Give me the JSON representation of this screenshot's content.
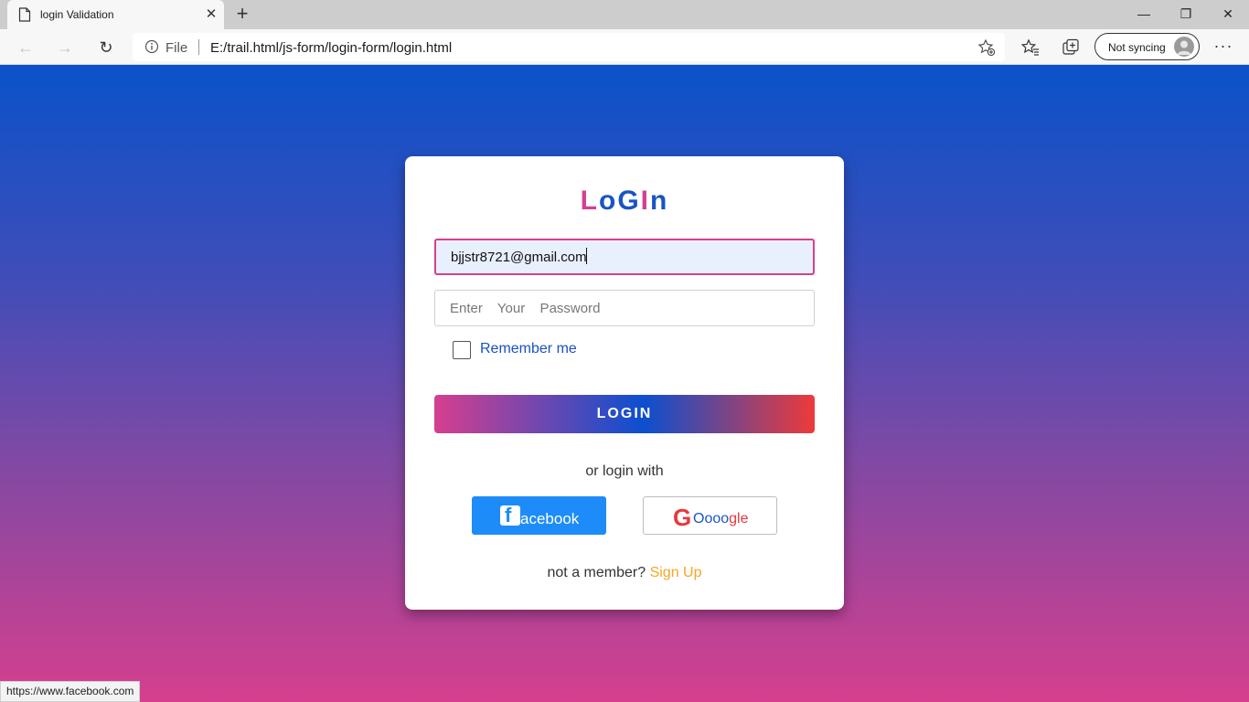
{
  "browser": {
    "tab_title": "login Validation",
    "tab_close": "✕",
    "new_tab": "+",
    "window_controls": {
      "minimize": "—",
      "maximize": "❐",
      "close": "✕"
    },
    "nav": {
      "back": "←",
      "forward": "→",
      "reload": "↻"
    },
    "address": {
      "file_label": "File",
      "url": "E:/trail.html/js-form/login-form/login.html"
    },
    "profile_label": "Not syncing",
    "more": "···",
    "status_url": "https://www.facebook.com"
  },
  "login": {
    "title_letters": [
      "L",
      "o",
      "G",
      "I",
      "n"
    ],
    "title_colors": [
      "#d63f8e",
      "#1b53c4",
      "#1b53c4",
      "#d63f8e",
      "#1b53c4"
    ],
    "email_value": "bjjstr8721@gmail.com",
    "password_placeholder": "Enter  Your  Password",
    "remember_label": "Remember me",
    "login_button": "LOGIN",
    "or_text": "or login with",
    "facebook": {
      "logo_letter": "f",
      "label": "acebook"
    },
    "google": {
      "logo_letter": "G",
      "label_part1": "Oooo",
      "label_part2": "gle"
    },
    "member_text": "not a member?",
    "signup_link": "Sign Up"
  },
  "colors": {
    "gradient_top": "#0a52c9",
    "gradient_bottom": "#d63f8e",
    "email_border": "#d63f8e",
    "facebook_blue": "#1d8cf8",
    "signup_orange": "#f5a623"
  }
}
